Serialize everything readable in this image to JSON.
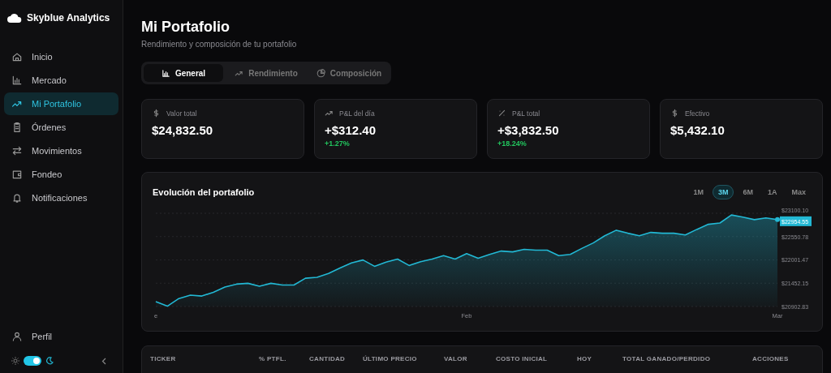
{
  "sidebar": {
    "brand": "Skyblue Analytics",
    "items": [
      {
        "label": "Inicio",
        "selected": false
      },
      {
        "label": "Mercado",
        "selected": false
      },
      {
        "label": "Mi Portafolio",
        "selected": true
      },
      {
        "label": "Órdenes",
        "selected": false
      },
      {
        "label": "Movimientos",
        "selected": false
      },
      {
        "label": "Fondeo",
        "selected": false
      },
      {
        "label": "Notificaciones",
        "selected": false
      }
    ],
    "profile": "Perfil",
    "dark_mode": true
  },
  "header": {
    "title": "Mi Portafolio",
    "subtitle": "Rendimiento y composición de tu portafolio"
  },
  "tabs": [
    {
      "label": "General",
      "selected": true
    },
    {
      "label": "Rendimiento",
      "selected": false
    },
    {
      "label": "Composición",
      "selected": false
    }
  ],
  "stats": [
    {
      "label": "Valor total",
      "value": "$24,832.50"
    },
    {
      "label": "P&L del día",
      "value": "+$312.40",
      "change": "+1.27%"
    },
    {
      "label": "P&L total",
      "value": "+$3,832.50",
      "change": "+18.24%"
    },
    {
      "label": "Efectivo",
      "value": "$5,432.10"
    }
  ],
  "chart_card": {
    "title": "Evolución del portafolio",
    "ranges": [
      {
        "label": "1M",
        "selected": false
      },
      {
        "label": "3M",
        "selected": true
      },
      {
        "label": "6M",
        "selected": false
      },
      {
        "label": "1A",
        "selected": false
      },
      {
        "label": "Max",
        "selected": false
      }
    ],
    "last_label": "$22954.55",
    "chart_data": {
      "type": "area",
      "grid": true,
      "ylim": [
        20902.83,
        23100.1
      ],
      "yticks": [
        {
          "value": 20902.83,
          "label": "$20902.83"
        },
        {
          "value": 21452.15,
          "label": "$21452.15"
        },
        {
          "value": 22001.47,
          "label": "$22001.47"
        },
        {
          "value": 22550.78,
          "label": "$22550.78"
        },
        {
          "value": 23100.1,
          "label": "$23100.10"
        }
      ],
      "categories": [
        "e",
        null,
        null,
        null,
        null,
        null,
        null,
        null,
        null,
        null,
        null,
        null,
        null,
        null,
        null,
        null,
        null,
        null,
        null,
        null,
        null,
        null,
        null,
        null,
        null,
        null,
        null,
        "Feb",
        null,
        null,
        null,
        null,
        null,
        null,
        null,
        null,
        null,
        null,
        null,
        null,
        null,
        null,
        null,
        null,
        null,
        null,
        null,
        null,
        null,
        null,
        null,
        null,
        null,
        null,
        "Mar"
      ],
      "series": [
        {
          "color": "#22b8d4",
          "values": [
            21020,
            20910,
            21090,
            21170,
            21150,
            21240,
            21360,
            21430,
            21450,
            21380,
            21450,
            21410,
            21410,
            21570,
            21590,
            21680,
            21810,
            21930,
            22000,
            21850,
            21950,
            22020,
            21870,
            21960,
            22020,
            22100,
            22020,
            22150,
            22040,
            22130,
            22210,
            22190,
            22250,
            22230,
            22230,
            22100,
            22130,
            22270,
            22400,
            22570,
            22700,
            22630,
            22570,
            22650,
            22630,
            22630,
            22590,
            22720,
            22840,
            22870,
            23060,
            23010,
            22950,
            22990,
            22950
          ]
        }
      ]
    }
  },
  "table": {
    "columns": [
      "TICKER",
      "% PTFL.",
      "CANTIDAD",
      "ÚLTIMO PRECIO",
      "VALOR",
      "COSTO INICIAL",
      "HOY",
      "TOTAL GANADO/PERDIDO",
      "ACCIONES"
    ]
  }
}
